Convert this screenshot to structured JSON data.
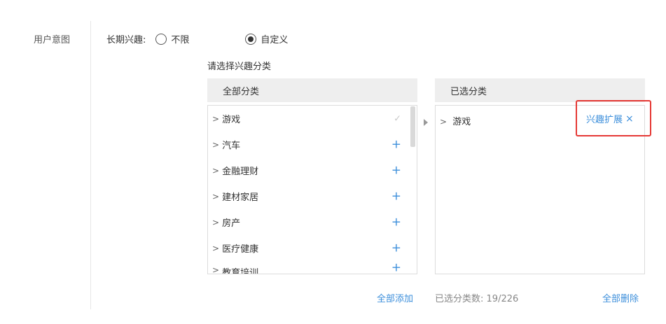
{
  "section": {
    "label": "用户意图"
  },
  "interest": {
    "label": "长期兴趣:",
    "options": [
      {
        "label": "不限",
        "checked": false
      },
      {
        "label": "自定义",
        "checked": true
      }
    ]
  },
  "choose_title": "请选择兴趣分类",
  "all_panel": {
    "header": "全部分类",
    "items": [
      {
        "label": "游戏",
        "chevron": ">",
        "action": "✓",
        "added": true
      },
      {
        "label": "汽车",
        "chevron": ">",
        "action": "+",
        "added": false
      },
      {
        "label": "金融理财",
        "chevron": ">",
        "action": "+",
        "added": false
      },
      {
        "label": "建材家居",
        "chevron": ">",
        "action": "+",
        "added": false
      },
      {
        "label": "房产",
        "chevron": ">",
        "action": "+",
        "added": false
      },
      {
        "label": "医疗健康",
        "chevron": ">",
        "action": "+",
        "added": false
      },
      {
        "label": "教育培训",
        "chevron": ">",
        "action": "+",
        "added": false
      }
    ]
  },
  "selected_panel": {
    "header": "已选分类",
    "items": [
      {
        "label": "游戏",
        "chevron": ">"
      }
    ],
    "expand_label": "兴趣扩展",
    "expand_close": "×"
  },
  "footer": {
    "add_all": "全部添加",
    "count_label": "已选分类数:",
    "count_value": "19/226",
    "delete_all": "全部删除"
  },
  "colors": {
    "accent": "#3d8fdb",
    "highlight": "#e53935"
  }
}
